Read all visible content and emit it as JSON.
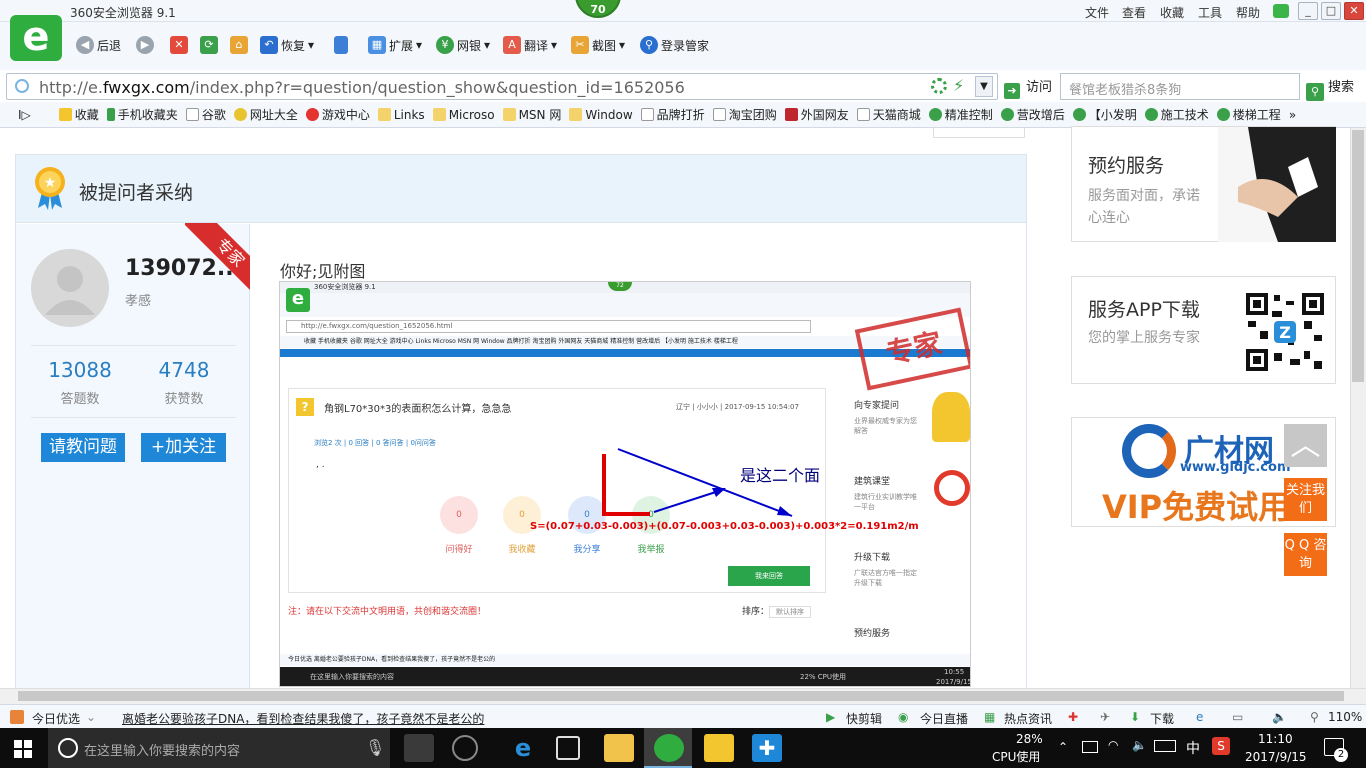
{
  "browser": {
    "title": "360安全浏览器 9.1",
    "badge": "70",
    "menu": [
      "文件",
      "查看",
      "收藏",
      "工具",
      "帮助"
    ],
    "window_buttons": [
      "_",
      "□",
      "✕"
    ]
  },
  "toolbar": {
    "back": "后退",
    "restore": "恢复",
    "extend": "扩展",
    "bank": "网银",
    "translate": "翻译",
    "screenshot": "截图",
    "login": "登录管家"
  },
  "address": {
    "url_prefix": "http://e.",
    "url_domain": "fwxgx.com",
    "url_rest": "/index.php?r=question/question_show&question_id=1652056",
    "visit": "访问",
    "search_placeholder": "餐馆老板猎杀8条狗",
    "search": "搜索"
  },
  "bookmarks": [
    "收藏",
    "手机收藏夹",
    "谷歌",
    "网址大全",
    "游戏中心",
    "Links",
    "Microso",
    "MSN 网",
    "Window",
    "品牌打折",
    "淘宝团购",
    "外国网友",
    "天猫商城",
    "精准控制",
    "营改增后",
    "【小发明",
    "施工技术",
    "楼梯工程"
  ],
  "page": {
    "card_title": "被提问者采纳",
    "ribbon": "专家",
    "user_name": "139072...",
    "user_location": "孝感",
    "answers_count": "13088",
    "answers_label": "答题数",
    "likes_count": "4748",
    "likes_label": "获赞数",
    "ask_button": "请教问题",
    "follow_button": "+加关注",
    "greeting": "你好;见附图"
  },
  "embedded": {
    "title": "360安全浏览器 9.1",
    "badge": "72",
    "url": "http://e.fwxgx.com/question_1652056.html",
    "bookmarks": "收藏  手机收藏夹  谷歌  网址大全  游戏中心  Links  Microso  MSN 网  Window  品牌打折  淘宝团购  外国网友  天猫商城  精准控制  营改增后  【小发明  施工技术  楼梯工程",
    "question": "角钢L70*30*3的表面积怎么计算，急急急",
    "question_meta": "辽宁 | 小小小 | 2017-09-15 10:54:07",
    "question_stats": "浏览2 次 | 0 回答 | 0 答问答 | 0问问答",
    "dots": ", .",
    "counts": [
      "0",
      "0",
      "0",
      "0"
    ],
    "actions": [
      "问得好",
      "我收藏",
      "我分享",
      "我举报"
    ],
    "answer_button": "我来回答",
    "note": "注：请在以下交流中文明用语，共创和谐交流圈！",
    "sort_label": "排序：",
    "sort_value": "默认排序",
    "stamp": "专家",
    "annotation": "是这二个面",
    "formula": "S=(0.07+0.03-0.003)+(0.07-0.003+0.03-0.003)+0.003*2=0.191m2/m",
    "side": [
      "向专家提问",
      "业界最权威专家为您解答",
      "建筑课堂",
      "建筑行业实训教学唯一平台",
      "升级下载",
      "广联达官方唯一指定升级下载",
      "预约服务"
    ],
    "status": "今日优选    离婚老公要验孩子DNA，看到检查结果我傻了，孩子竟然不是老公的",
    "taskbar_search": "在这里输入你要搜索的内容",
    "cpu": "22%  CPU使用",
    "clock_time": "10:55",
    "clock_date": "2017/9/15"
  },
  "sidebar": {
    "booking_title": "预约服务",
    "booking_sub": "服务面对面，承诺心连心",
    "app_title": "服务APP下载",
    "app_sub": "您的掌上服务专家",
    "ad_brand": "广材网",
    "ad_url": "www.gldjc.com",
    "ad_vip": "VIP免费试用",
    "follow_us": "关注我们",
    "qq": "Q Q 咨询",
    "back_to_top": "︿"
  },
  "statusbar": {
    "today": "今日优选",
    "headline": "离婚老公要验孩子DNA，看到检查结果我傻了，孩子竟然不是老公的",
    "clip": "快剪辑",
    "live": "今日直播",
    "hot": "热点资讯",
    "download": "下载",
    "zoom": "110%"
  },
  "taskbar": {
    "search": "在这里输入你要搜索的内容",
    "cpu_pct": "28%",
    "cpu_label": "CPU使用",
    "ime": "中",
    "time": "11:10",
    "date": "2017/9/15",
    "notif": "2"
  },
  "colors": {
    "accent_blue": "#1f87d8",
    "brand_green": "#2fae3f",
    "ribbon_red": "#d82d2d",
    "orange": "#f36c16"
  }
}
